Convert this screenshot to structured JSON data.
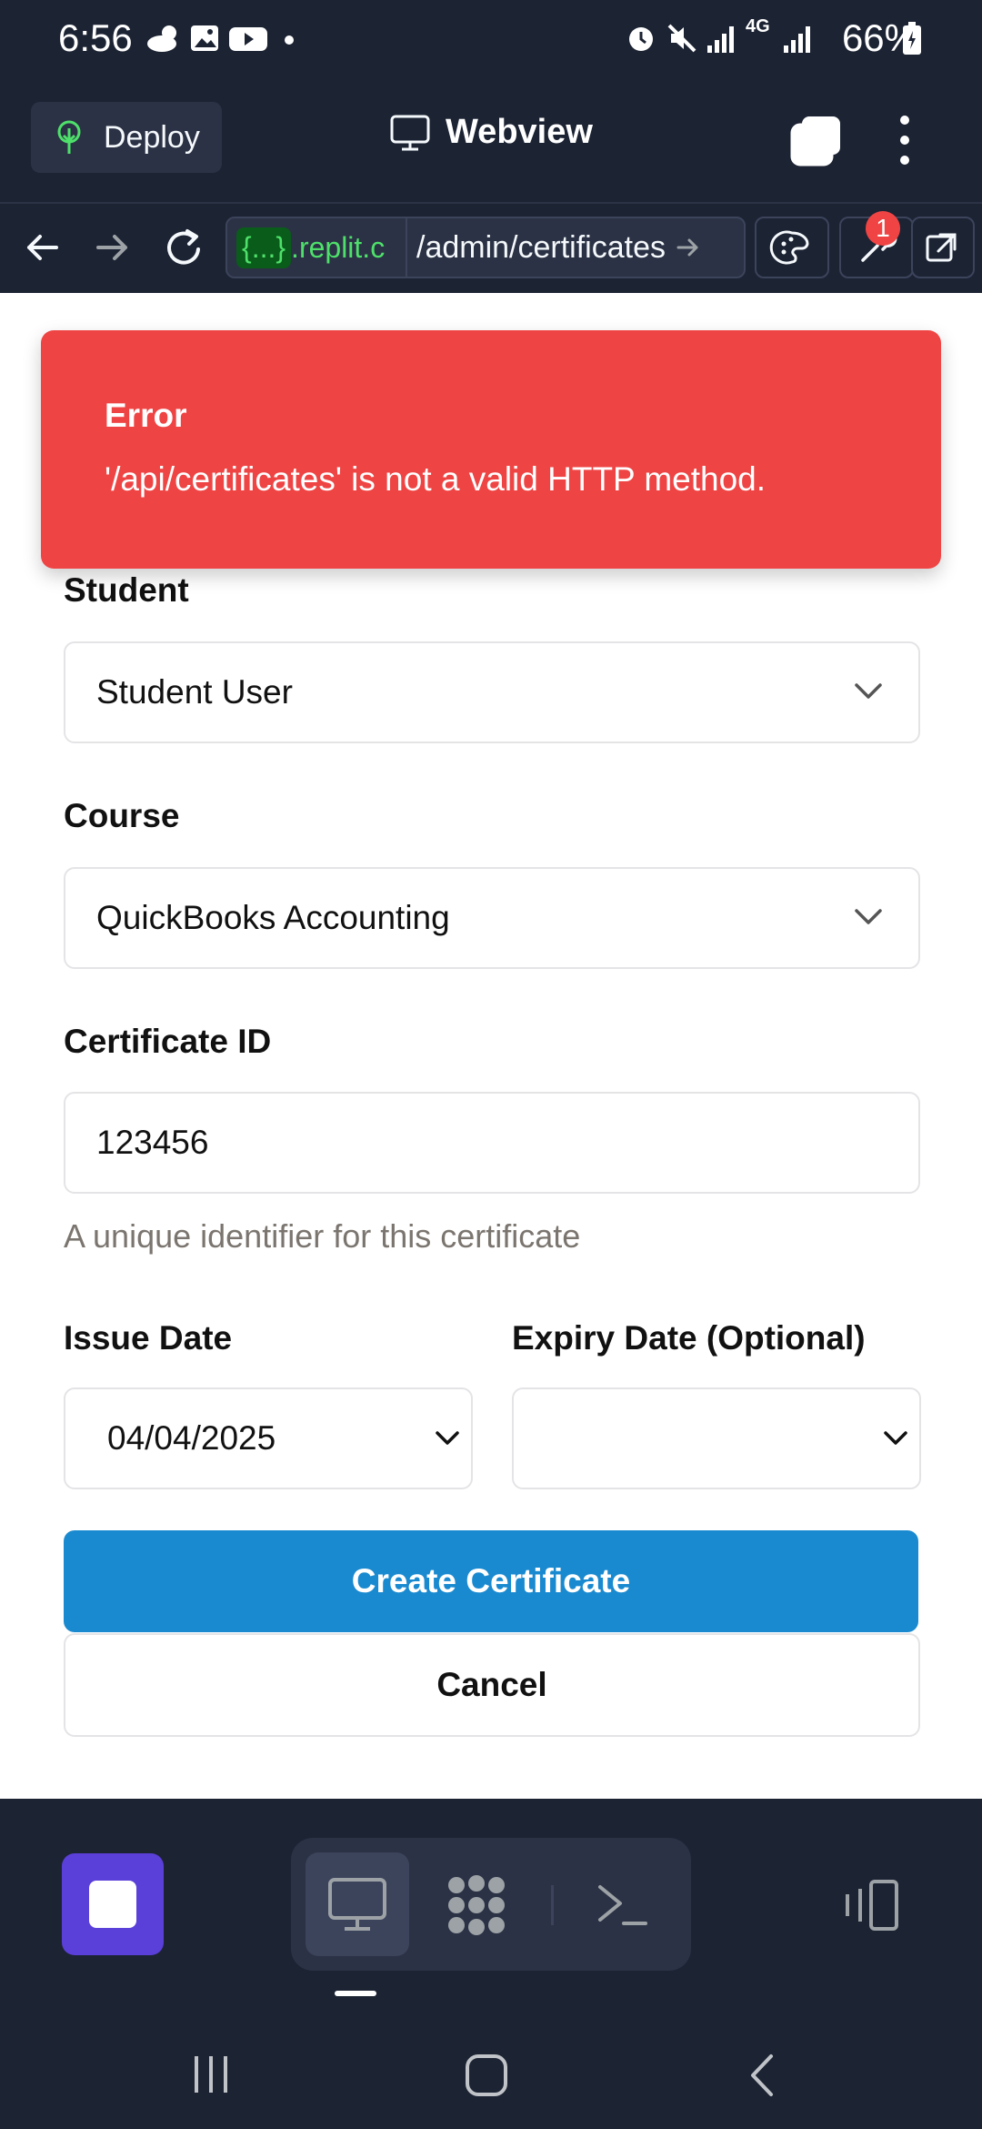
{
  "status_bar": {
    "time": "6:56",
    "battery": "66%",
    "network": "4G",
    "icons": [
      "cloud-sun-icon",
      "image-icon",
      "youtube-icon",
      "dot-icon",
      "alarm-icon",
      "mute-icon",
      "signal-icon",
      "signal-icon",
      "battery-icon"
    ]
  },
  "app_header": {
    "deploy_label": "Deploy",
    "title": "Webview",
    "icons": [
      "deploy-tree-icon",
      "monitor-icon",
      "tabs-icon",
      "more-vert-icon"
    ]
  },
  "url_bar": {
    "host_tag": "{...}",
    "host_rest": ".replit.c",
    "path": "/admin/certificates",
    "badge_count": "1"
  },
  "error_toast": {
    "title": "Error",
    "message": "'/api/certificates' is not a valid HTTP method."
  },
  "form": {
    "student": {
      "label": "Student",
      "value": "Student User"
    },
    "course": {
      "label": "Course",
      "value": "QuickBooks Accounting"
    },
    "certificate_id": {
      "label": "Certificate ID",
      "value": "123456",
      "help": "A unique identifier for this certificate"
    },
    "issue_date": {
      "label": "Issue Date",
      "value": "04/04/2025"
    },
    "expiry_date": {
      "label": "Expiry Date (Optional)",
      "value": ""
    },
    "create_label": "Create Certificate",
    "cancel_label": "Cancel"
  },
  "colors": {
    "error": "#ef4444",
    "primary": "#1a8ad0",
    "dark_bg": "#1c2333",
    "stop_button": "#5b3fd9"
  }
}
